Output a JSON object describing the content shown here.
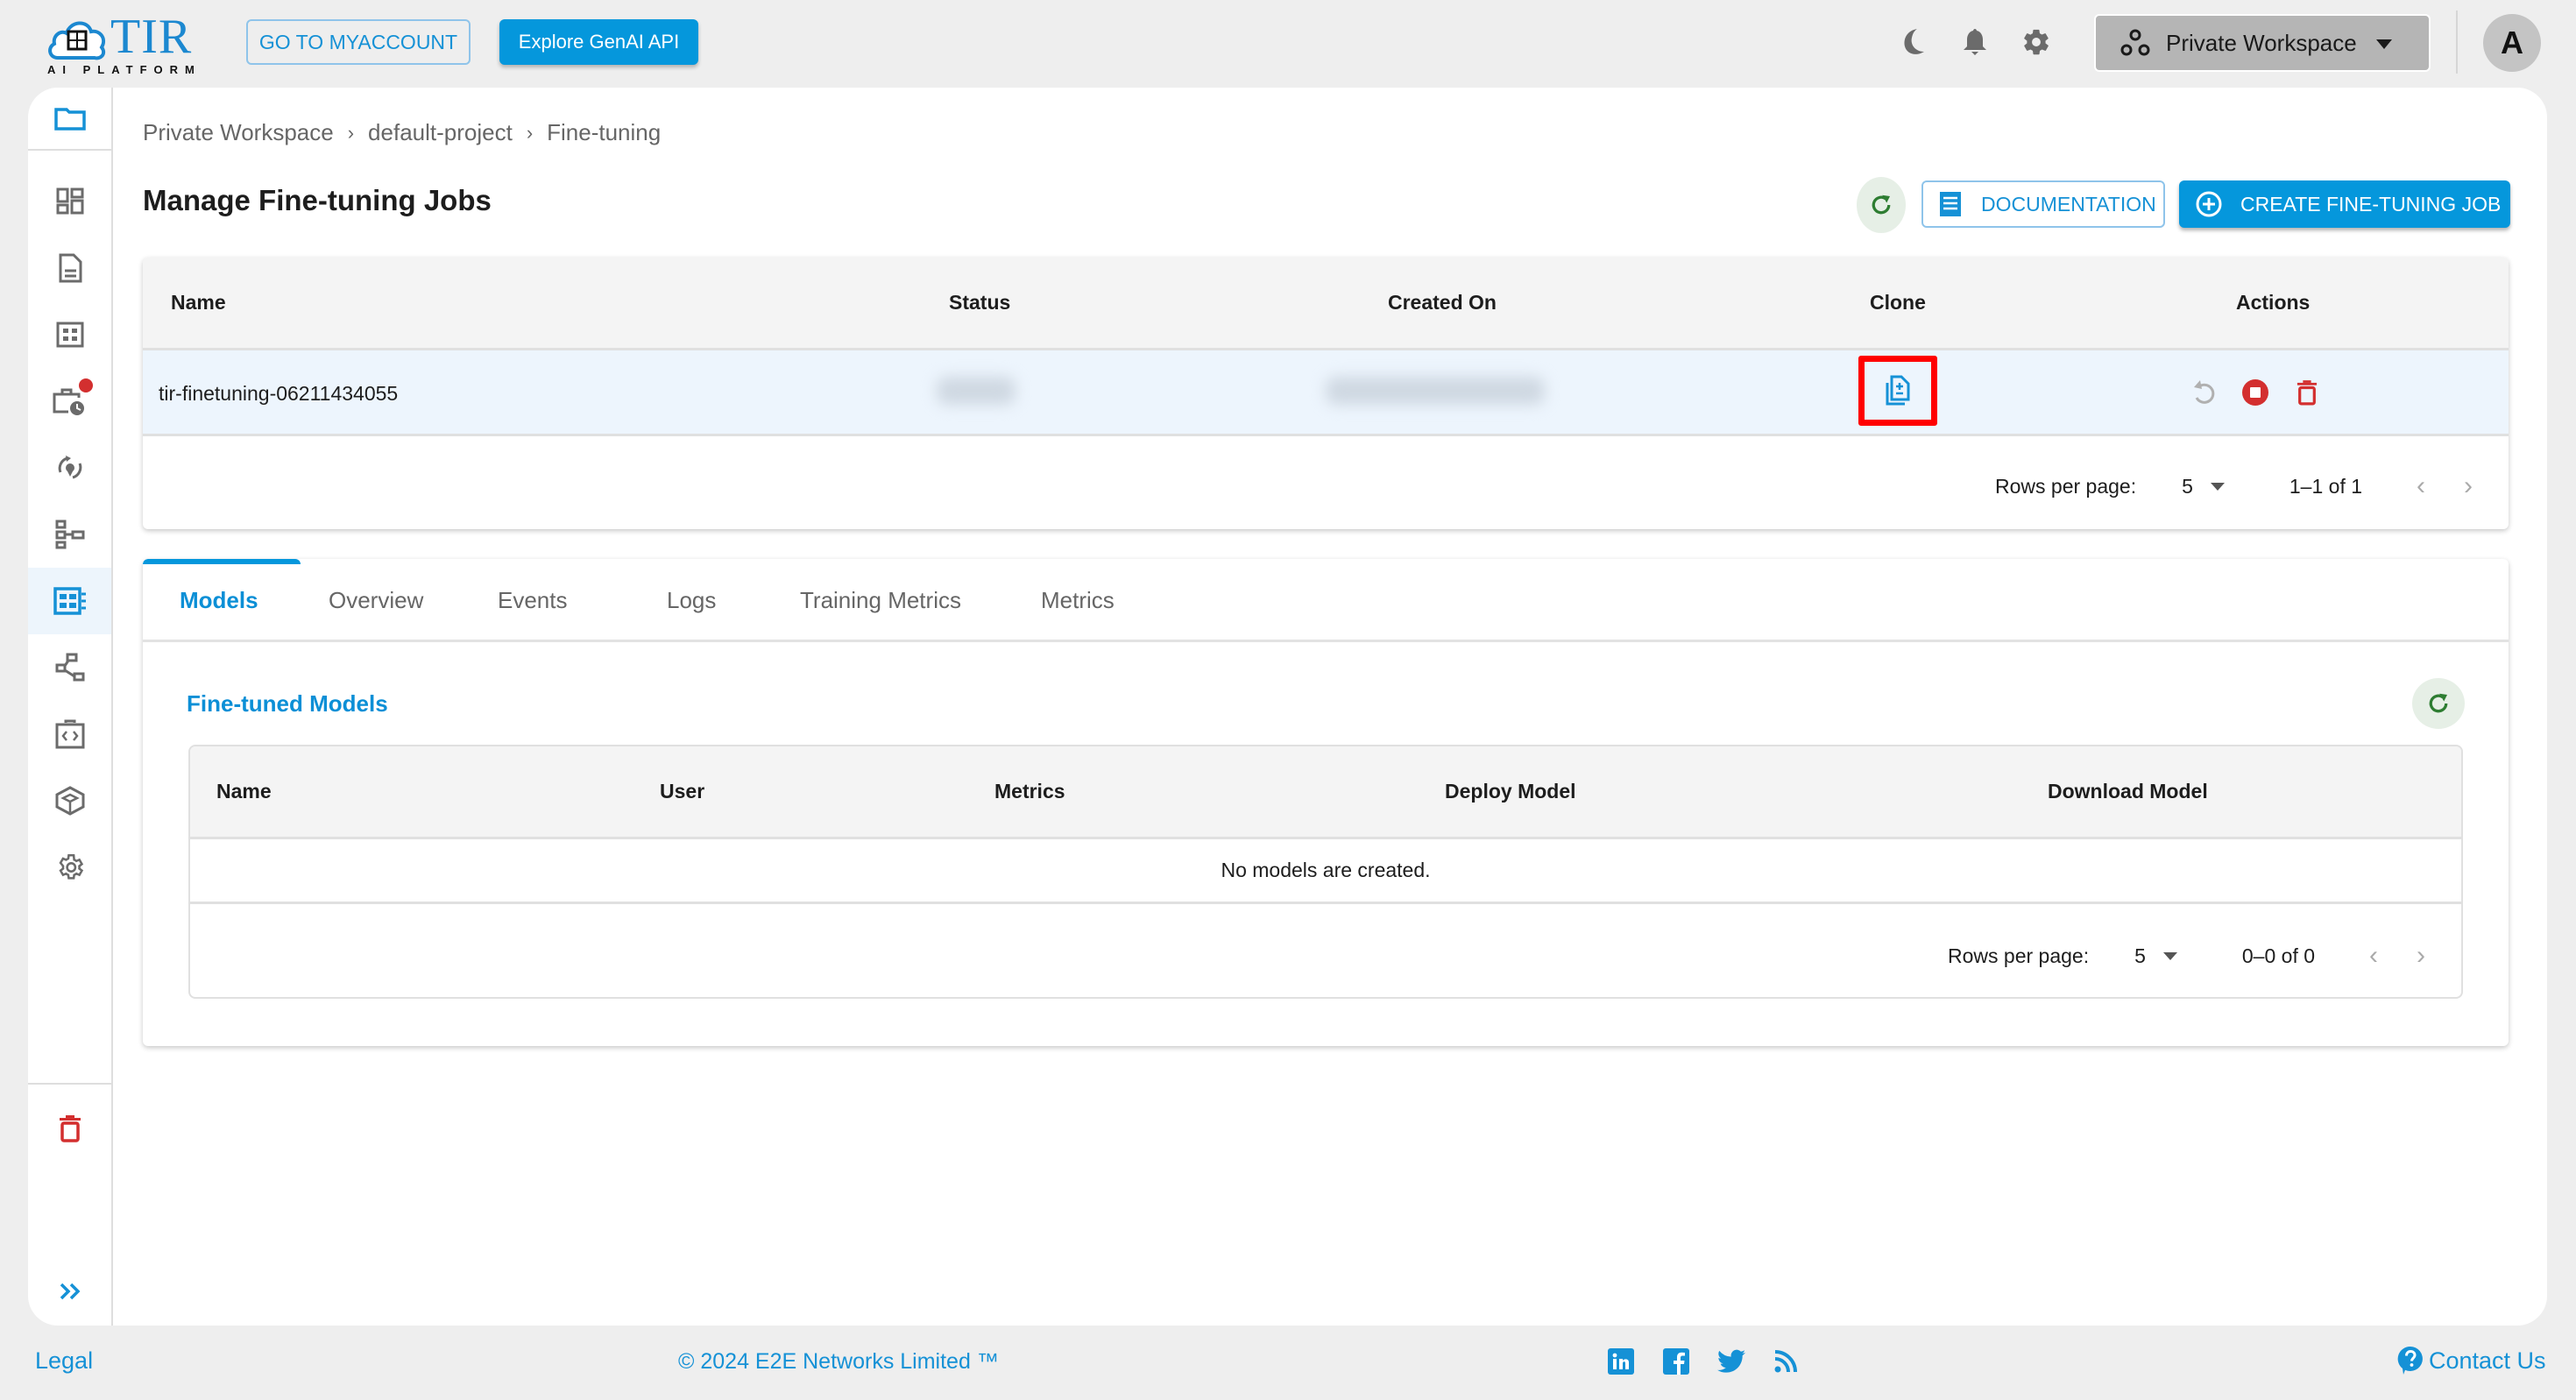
{
  "topbar": {
    "logo_text": "TIR",
    "logo_subtext": "AI PLATFORM",
    "myaccount_label": "GO TO MYACCOUNT",
    "genai_label": "Explore GenAI API",
    "icons": [
      "moon-icon",
      "bell-icon",
      "gear-icon"
    ],
    "workspace": "Private Workspace",
    "avatar_initial": "A"
  },
  "sidebar": {
    "items": [
      {
        "icon": "folder-icon",
        "active": false
      },
      {
        "icon": "dashboard-icon",
        "active": false
      },
      {
        "icon": "document-icon",
        "active": false
      },
      {
        "icon": "grid-icon",
        "active": false
      },
      {
        "icon": "scheduled-jobs-icon",
        "active": false,
        "badge": true
      },
      {
        "icon": "inference-icon",
        "active": false
      },
      {
        "icon": "pipeline-icon",
        "active": false
      },
      {
        "icon": "fine-tuning-icon",
        "active": true
      },
      {
        "icon": "share-graph-icon",
        "active": false
      },
      {
        "icon": "code-icon",
        "active": false
      },
      {
        "icon": "cube-icon",
        "active": false
      },
      {
        "icon": "settings-icon",
        "active": false
      }
    ],
    "bottom": [
      "trash-icon",
      "expand-icon"
    ]
  },
  "breadcrumb": [
    "Private Workspace",
    "default-project",
    "Fine-tuning"
  ],
  "page": {
    "title": "Manage Fine-tuning Jobs",
    "documentation_label": "DOCUMENTATION",
    "create_label": "CREATE FINE-TUNING JOB"
  },
  "jobs_table": {
    "columns": [
      "Name",
      "Status",
      "Created On",
      "Clone",
      "Actions"
    ],
    "rows": [
      {
        "name": "tir-finetuning-06211434055",
        "status": "[blurred]",
        "created_on": "[blurred]"
      }
    ],
    "rows_per_page_label": "Rows per page:",
    "rows_per_page": "5",
    "range": "1–1 of 1"
  },
  "tabs": {
    "items": [
      "Models",
      "Overview",
      "Events",
      "Logs",
      "Training Metrics",
      "Metrics"
    ],
    "active": "Models"
  },
  "models_section": {
    "title": "Fine-tuned Models",
    "columns": [
      "Name",
      "User",
      "Metrics",
      "Deploy Model",
      "Download Model"
    ],
    "empty_message": "No models are created.",
    "rows_per_page_label": "Rows per page:",
    "rows_per_page": "5",
    "range": "0–0 of 0"
  },
  "footer": {
    "legal": "Legal",
    "copyright": "© 2024 E2E Networks Limited ™",
    "social": [
      "linkedin-icon",
      "facebook-icon",
      "twitter-icon",
      "rss-icon"
    ],
    "contact": "Contact Us"
  },
  "colors": {
    "accent": "#0597dc",
    "danger": "#d32f2f",
    "refresh_green": "#2e7d32",
    "highlight_red": "#ff0000"
  }
}
